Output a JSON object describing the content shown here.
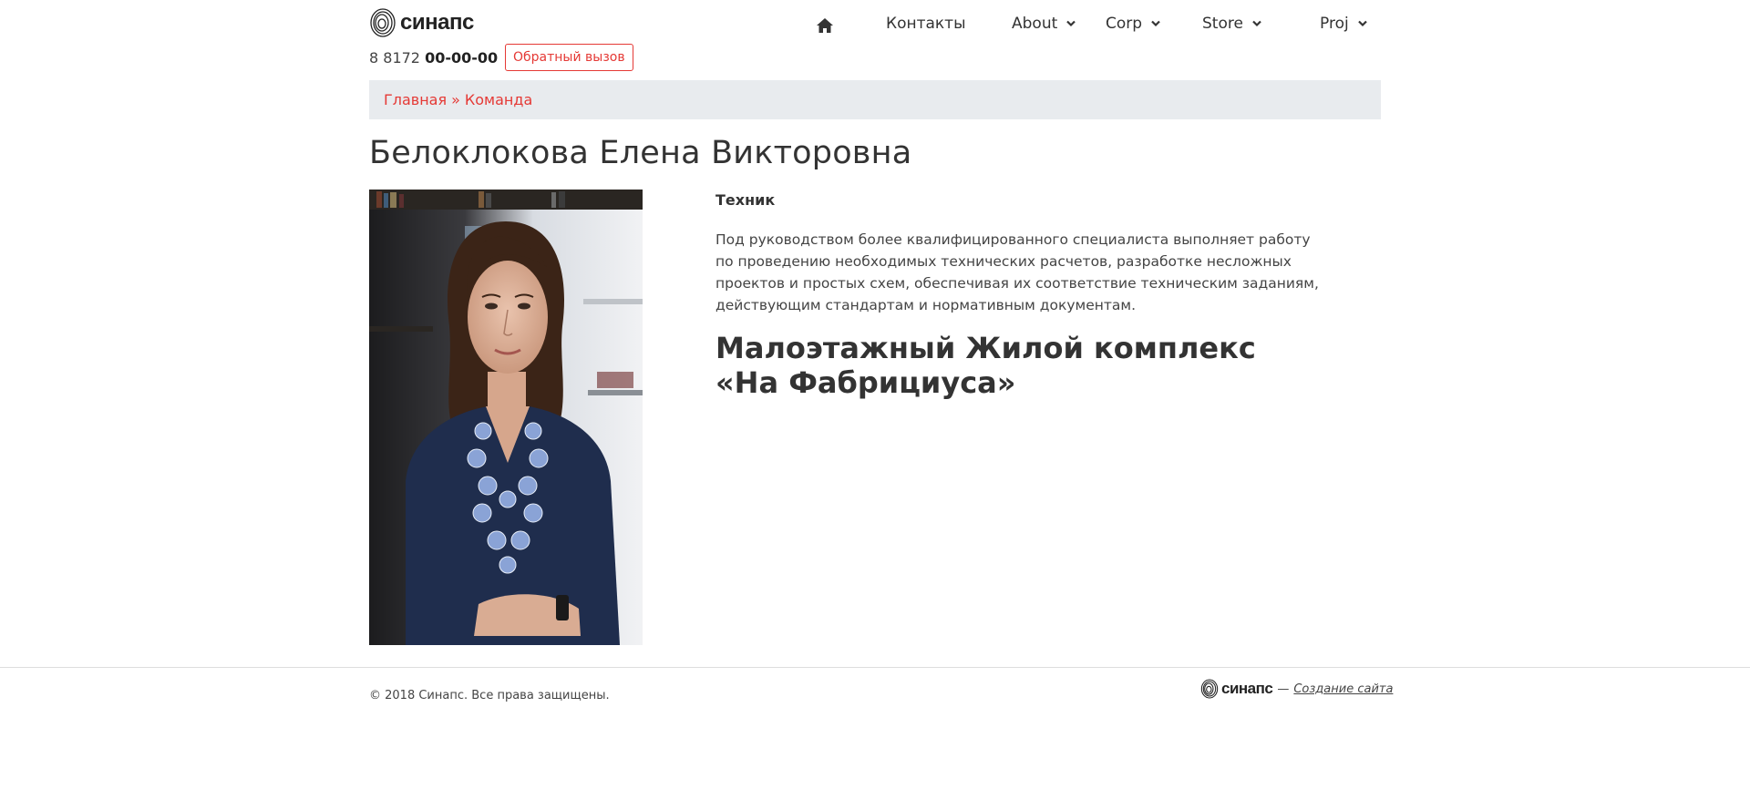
{
  "header": {
    "logo_text": "синапс",
    "phone_prefix": "8 8172 ",
    "phone_number": "00-00-00",
    "callback_label": "Обратный вызов"
  },
  "nav": {
    "contacts": "Контакты",
    "about": "About",
    "corp": "Corp",
    "store": "Store",
    "proj": "Proj"
  },
  "breadcrumb": {
    "home": "Главная",
    "separator": "»",
    "team": "Команда"
  },
  "page": {
    "title": "Белоклокова Елена Викторовна",
    "position": "Техник",
    "description": "Под руководством более квалифицированного специалиста выполняет работу по проведению необходимых технических расчетов, разработке несложных проектов и простых схем, обеспечивая их соответствие техническим заданиям, действующим стандартам и нормативным документам.",
    "project": "Малоэтажный Жилой комплекс «На Фабрициуса»"
  },
  "footer": {
    "copyright": "© 2018 Синапс. Все права защищены.",
    "logo_text": "синапс",
    "dash": "—",
    "credit_link": "Создание сайта"
  },
  "colors": {
    "accent": "#e53935",
    "breadcrumb_bg": "#e8ebee",
    "text": "#333333"
  }
}
